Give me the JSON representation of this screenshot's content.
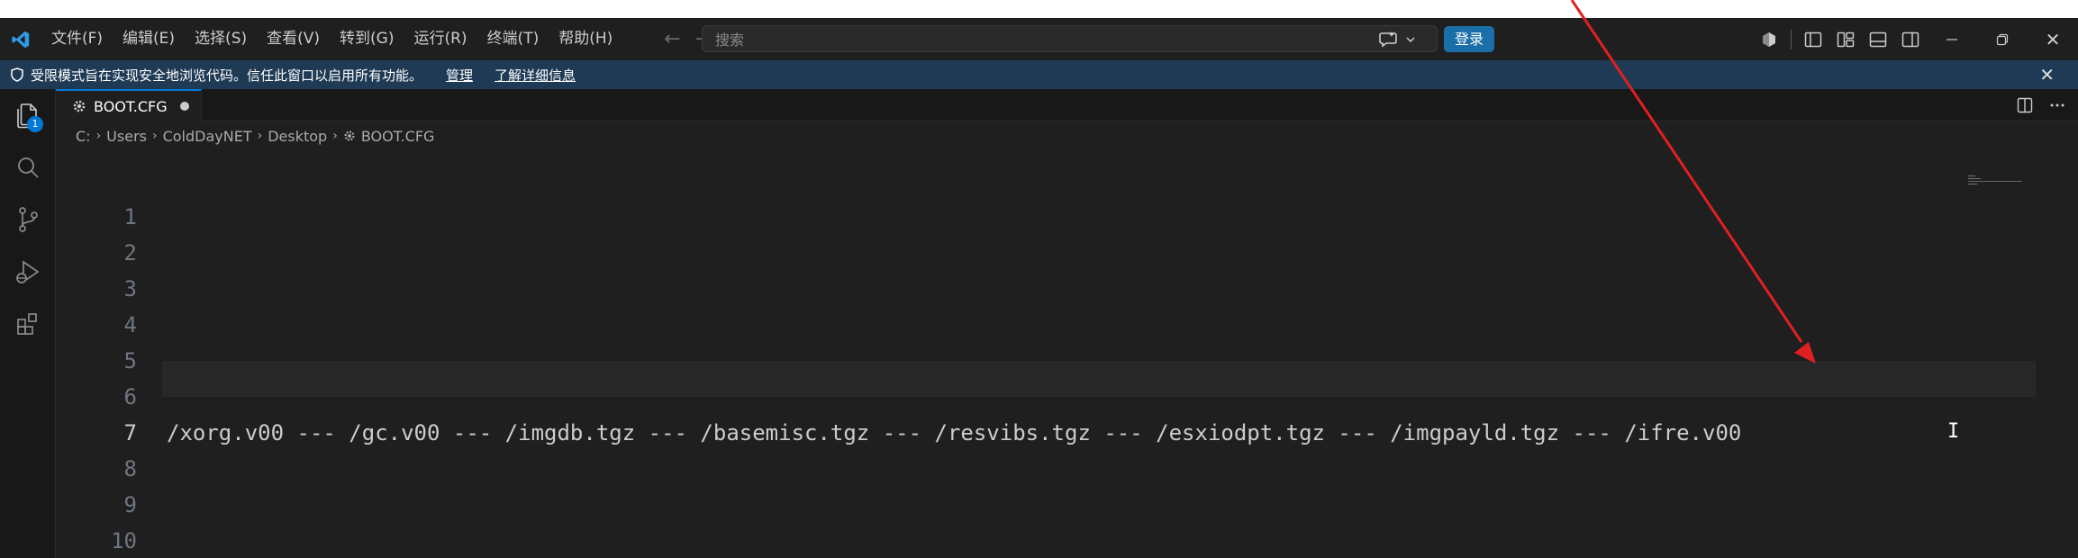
{
  "menu": {
    "items": [
      "文件(F)",
      "编辑(E)",
      "选择(S)",
      "查看(V)",
      "转到(G)",
      "运行(R)",
      "终端(T)",
      "帮助(H)"
    ]
  },
  "search": {
    "placeholder": "搜索"
  },
  "account": {
    "signin_label": "登录"
  },
  "window": {
    "close": "✕"
  },
  "banner": {
    "message": "受限模式旨在实现安全地浏览代码。信任此窗口以启用所有功能。",
    "manage_label": "管理",
    "learn_more_label": "了解详细信息",
    "close": "✕"
  },
  "activity": {
    "explorer_badge": "1"
  },
  "tab": {
    "name": "BOOT.CFG"
  },
  "breadcrumb": [
    "C:",
    "Users",
    "ColdDayNET",
    "Desktop",
    "BOOT.CFG"
  ],
  "editor": {
    "line_numbers": [
      "1",
      "2",
      "3",
      "4",
      "5",
      "6",
      "7",
      "8",
      "9",
      "10"
    ],
    "active_line": 7,
    "line7_text": "/xorg.v00 --- /gc.v00 --- /imgdb.tgz --- /basemisc.tgz --- /resvibs.tgz --- /esxiodpt.tgz --- /imgpayld.tgz --- /ifre.v00"
  },
  "colors": {
    "accent": "#0078d4",
    "signin_bg": "#1a6fa8",
    "banner_bg": "#1e3a54",
    "annotation_arrow": "#e02020"
  }
}
